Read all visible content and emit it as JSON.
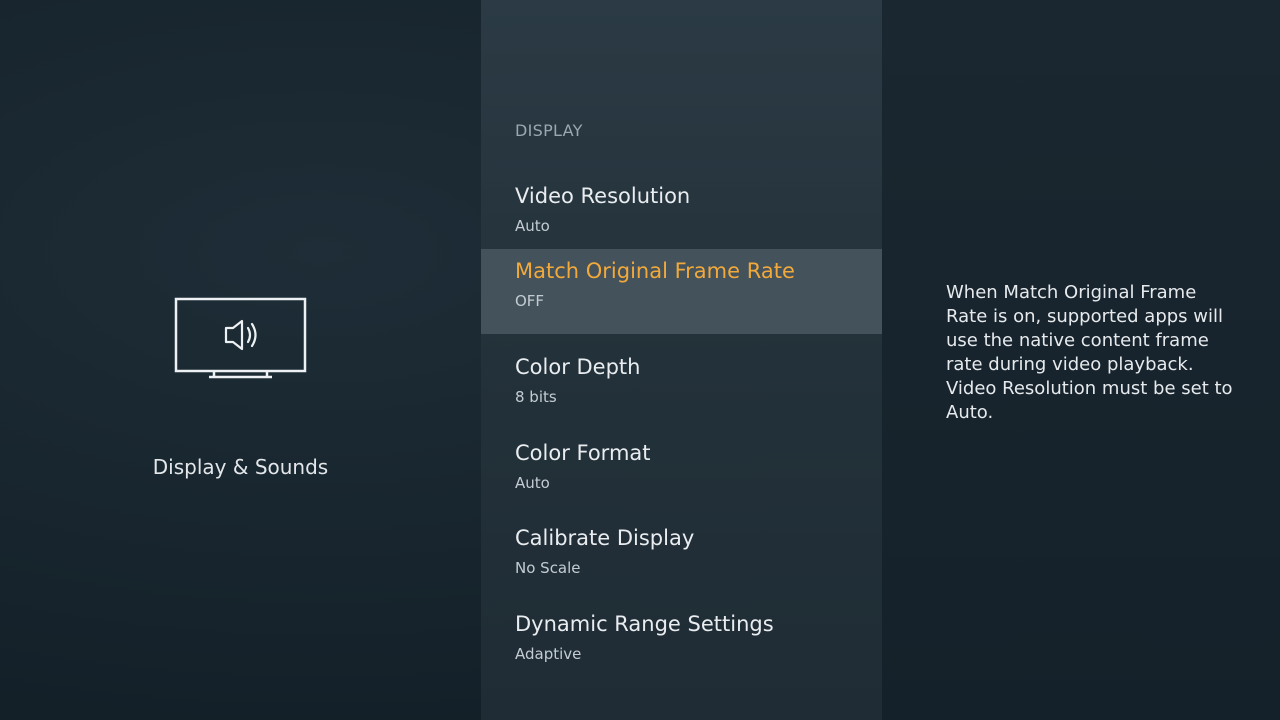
{
  "left": {
    "icon": "tv-speaker-icon",
    "title": "Display & Sounds"
  },
  "menu": {
    "header": "DISPLAY",
    "selected_index": 1,
    "items": [
      {
        "label": "Video Resolution",
        "value": "Auto"
      },
      {
        "label": "Match Original Frame Rate",
        "value": "OFF"
      },
      {
        "label": "Color Depth",
        "value": "8 bits"
      },
      {
        "label": "Color Format",
        "value": "Auto"
      },
      {
        "label": "Calibrate Display",
        "value": "No Scale"
      },
      {
        "label": "Dynamic Range Settings",
        "value": "Adaptive"
      }
    ]
  },
  "description": {
    "text": "When Match Original Frame Rate is on, supported apps will use the native content frame rate during video playback. Video Resolution must be set to Auto."
  },
  "colors": {
    "selected_text": "#f2a93b",
    "selected_bg": "#44525c"
  }
}
